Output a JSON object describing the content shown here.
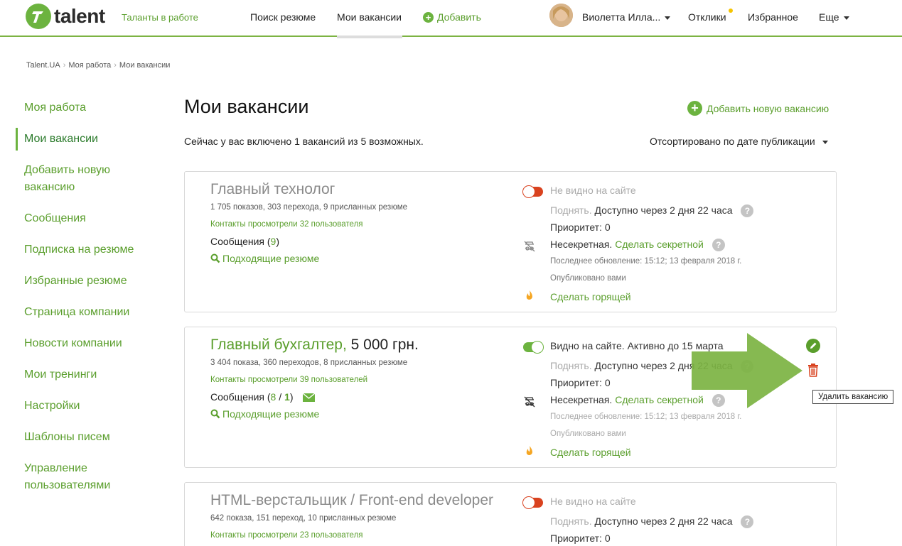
{
  "header": {
    "logo_text": "talent",
    "slogan": "Таланты в работе",
    "nav": {
      "search": "Поиск резюме",
      "my_vacancies": "Мои вакансии",
      "add": "Добавить"
    },
    "user_name": "Виолетта Илла...",
    "responses": "Отклики",
    "favorites": "Избранное",
    "more": "Еще"
  },
  "breadcrumb": [
    "Talent.UA",
    "Моя работа",
    "Мои вакансии"
  ],
  "sidebar": {
    "items": [
      {
        "label": "Моя работа"
      },
      {
        "label": "Мои вакансии"
      },
      {
        "label": "Добавить новую\nвакансию"
      },
      {
        "label": "Сообщения"
      },
      {
        "label": "Подписка на резюме"
      },
      {
        "label": "Избранные резюме"
      },
      {
        "label": "Страница компании"
      },
      {
        "label": "Новости компании"
      },
      {
        "label": "Мои тренинги"
      },
      {
        "label": "Настройки"
      },
      {
        "label": "Шаблоны писем"
      },
      {
        "label": "Управление\nпользователями"
      }
    ]
  },
  "main": {
    "title": "Мои вакансии",
    "add_vacancy": "Добавить новую вакансию",
    "summary": "Сейчас у вас включено 1 вакансий из 5 возможных.",
    "sort": "Отсортировано по дате публикации"
  },
  "vacancies": [
    {
      "title": "Главный технолог",
      "salary": "",
      "stats": "1 705 показов, 303 перехода, 9 присланных резюме",
      "contacts": "Контакты просмотрели 32 пользователя",
      "messages_label": "Сообщения (",
      "messages_count": "9",
      "messages_close": ")",
      "resumes_link": "Подходящие резюме",
      "visibility": "Не видно на сайте",
      "raise_label": "Поднять.",
      "raise_info": "Доступно через 2 дня 22 часа",
      "priority": "Приоритет: 0",
      "secret_label": "Несекретная.",
      "secret_link": "Сделать секретной",
      "updated": "Последнее обновление: 15:12; 13 февраля 2018 г.",
      "published": "Опубликовано вами",
      "hot_link": "Сделать горящей"
    },
    {
      "title": "Главный бухгалтер,",
      "salary": "5 000 грн.",
      "stats": "3 404 показа, 360 переходов, 8 присланных резюме",
      "contacts": "Контакты просмотрели 39 пользователей",
      "messages_label": "Сообщения (",
      "messages_count": "8",
      "messages_sep": " / ",
      "messages_new": "1",
      "messages_close": ")",
      "resumes_link": "Подходящие резюме",
      "visibility": "Видно на сайте. Активно до 15 марта",
      "raise_label": "Поднять.",
      "raise_info": "Доступно через 2 дня 22 часа",
      "priority": "Приоритет: 0",
      "secret_label": "Несекретная.",
      "secret_link": "Сделать секретной",
      "updated": "Последнее обновление: 15:12; 13 февраля 2018 г.",
      "published": "Опубликовано вами",
      "hot_link": "Сделать горящей"
    },
    {
      "title": "HTML-верстальщик / Front-end developer",
      "stats": "642 показа, 151 переход, 10 присланных резюме",
      "contacts": "Контакты просмотрели 23 пользователя",
      "visibility": "Не видно на сайте",
      "raise_label": "Поднять.",
      "raise_info": "Доступно через 2 дня 22 часа",
      "priority": "Приоритет: 0"
    }
  ],
  "tooltip": "Удалить вакансию",
  "colors": {
    "brand_green": "#6cb33f",
    "link_green": "#5a9e2c",
    "toggle_off": "#d9421f",
    "delete_red": "#d9421f",
    "arrow_green": "#7cb342"
  }
}
